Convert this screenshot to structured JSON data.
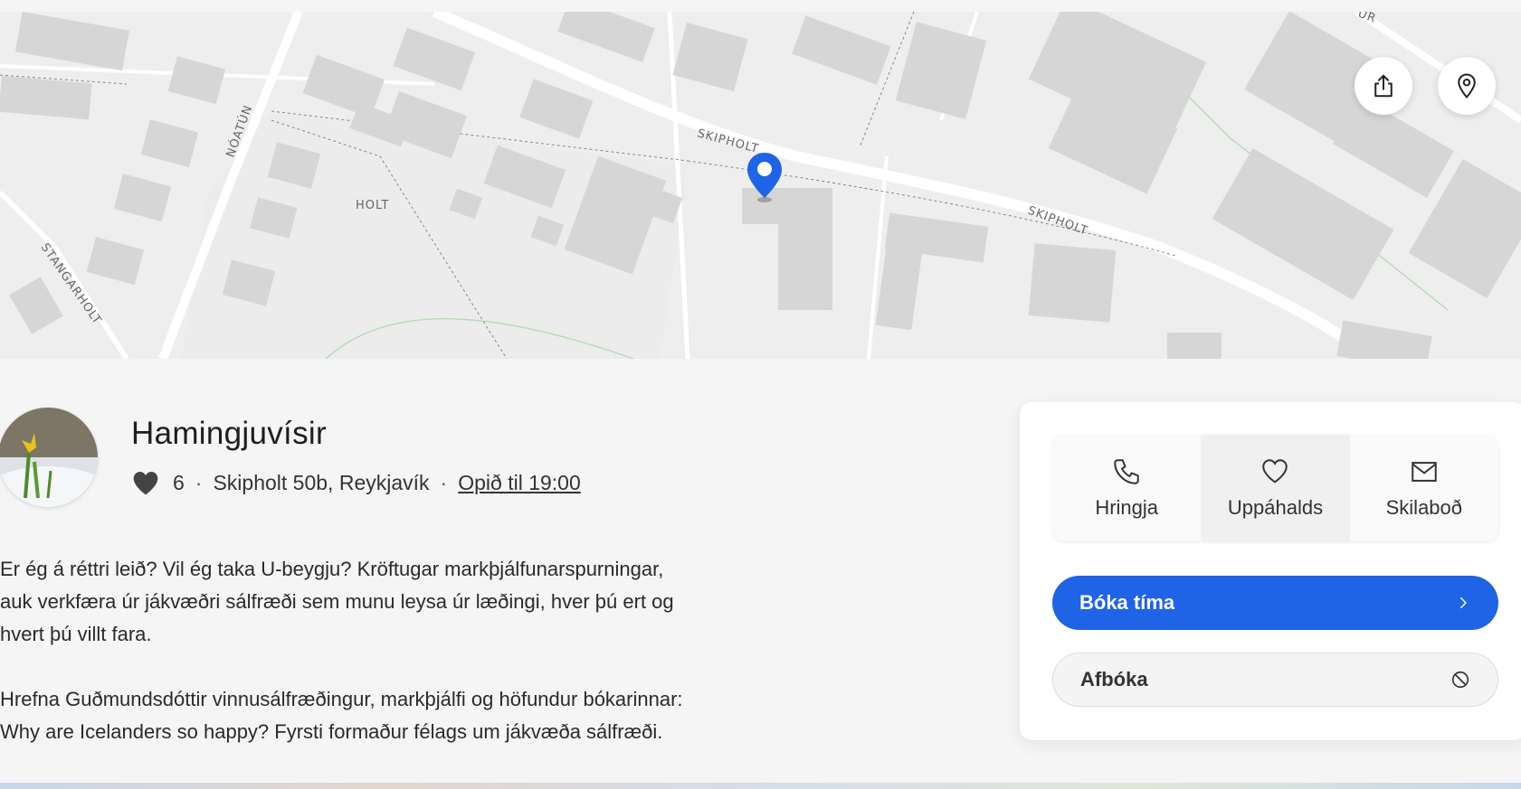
{
  "map": {
    "street_labels": [
      "SKIPHOLT",
      "SKIPHOLT",
      "NÓATÚN",
      "STANGARHOLT",
      "HOLT",
      "UR"
    ],
    "share_icon": "share-icon",
    "location_icon": "location-pin-icon",
    "marker_color": "#1f63e6"
  },
  "business": {
    "name": "Hamingjuvísir",
    "favorites_count": "6",
    "address": "Skipholt 50b, Reykjavík",
    "hours": "Opið til 19:00",
    "separator": "·",
    "description": [
      "Er ég á réttri leið? Vil ég taka U-beygju? Kröftugar markþjálfunarspurningar, auk verkfæra úr jákvæðri sálfræði sem munu leysa úr læðingi, hver þú ert og hvert þú villt fara.",
      "Hrefna Guðmundsdóttir vinnusálfræðingur, markþjálfi og höfundur bókarinnar: Why are Icelanders so happy? Fyrsti formaður félags um jákvæða sálfræði."
    ]
  },
  "actions": {
    "call": "Hringja",
    "favorite": "Uppáhalds",
    "message": "Skilaboð",
    "book": "Bóka tíma",
    "cancel": "Afbóka"
  },
  "colors": {
    "accent": "#1f63e6",
    "background": "#f5f5f5",
    "card": "#ffffff"
  }
}
